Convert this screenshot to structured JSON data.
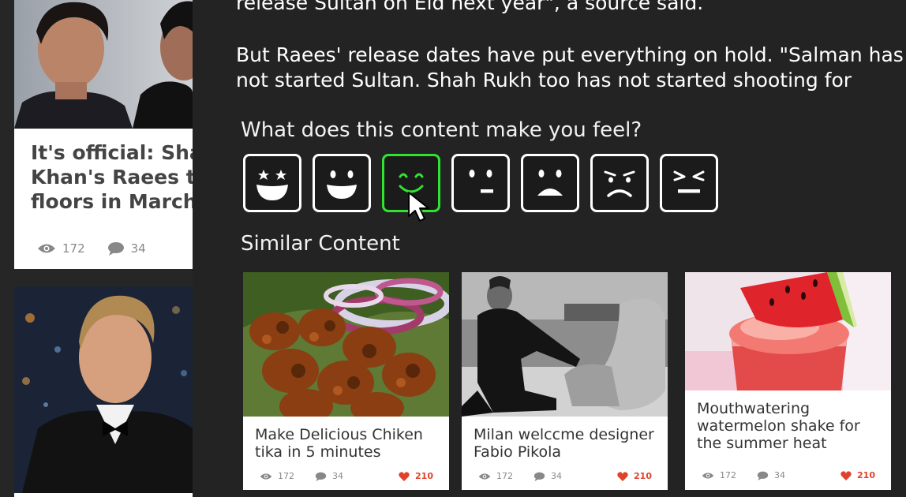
{
  "article": {
    "line0": "release Sultan on Eid next year\", a source said.",
    "line1": "But Raees' release dates have put everything on hold. \"Salman has",
    "line2": "not started Sultan. Shah Rukh too has not started shooting for"
  },
  "feedback": {
    "question": "What does this content make you feel?",
    "options": [
      "star-eyes",
      "happy",
      "smile",
      "meh",
      "sad",
      "upset",
      "angry"
    ],
    "selected": "smile",
    "selected_color": "#31e331"
  },
  "similar": {
    "heading": "Similar Content",
    "cards": [
      {
        "title_l1": "Make Delicious Chiken",
        "title_l2": "tika in 5 minutes",
        "title_l3": "",
        "views": "172",
        "comments": "34",
        "likes": "210"
      },
      {
        "title_l1": "Milan welccme designer",
        "title_l2": "Fabio Pikola",
        "title_l3": "",
        "views": "172",
        "comments": "34",
        "likes": "210"
      },
      {
        "title_l1": "Mouthwatering",
        "title_l2": "watermelon shake for",
        "title_l3": "the summer heat",
        "views": "172",
        "comments": "34",
        "likes": "210"
      }
    ]
  },
  "feed": {
    "card1": {
      "title_l1": "It's official: Sha",
      "title_l2": "Khan's Raees to",
      "title_l3": "floors in March",
      "views": "172",
      "comments": "34"
    }
  },
  "colors": {
    "accent_like": "#e0432b",
    "background": "#232323"
  }
}
